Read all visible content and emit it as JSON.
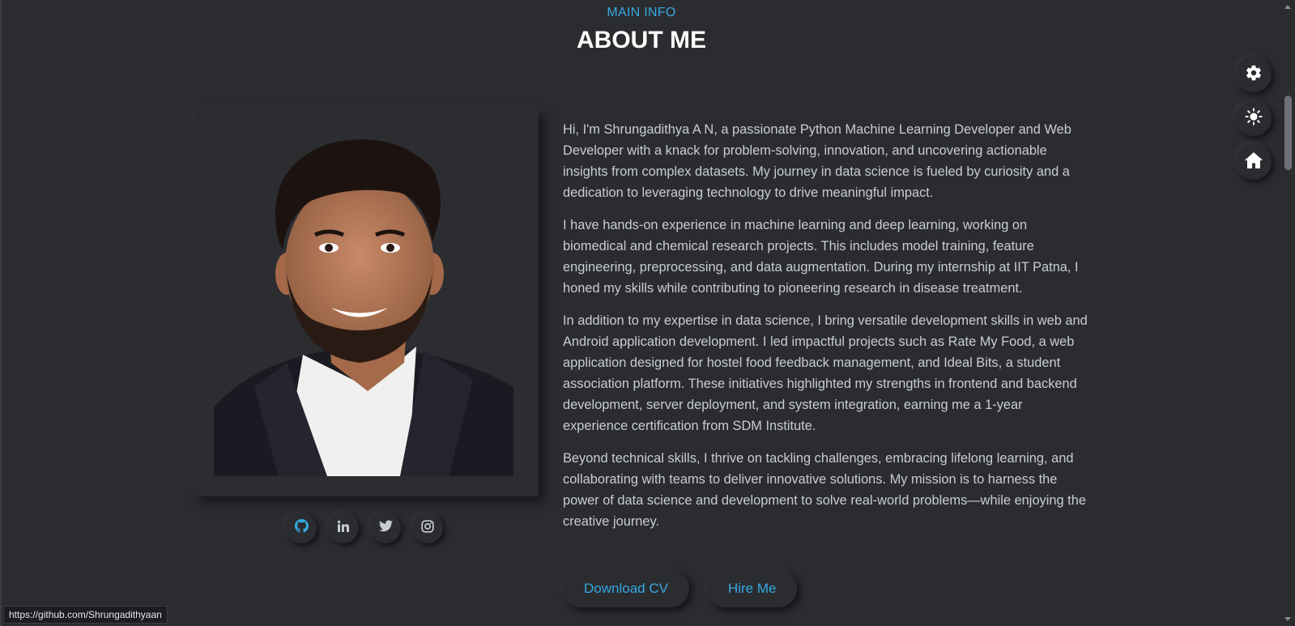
{
  "header": {
    "label": "MAIN INFO",
    "title": "ABOUT ME"
  },
  "profile": {
    "photo_alt": "Portrait of Shrungadithya A N"
  },
  "socials": [
    {
      "name": "GitHub",
      "icon": "github-icon",
      "color": "#36a9e1"
    },
    {
      "name": "LinkedIn",
      "icon": "linkedin-icon",
      "color": "#c9ccd1"
    },
    {
      "name": "Twitter",
      "icon": "twitter-icon",
      "color": "#c9ccd1"
    },
    {
      "name": "Instagram",
      "icon": "instagram-icon",
      "color": "#c9ccd1"
    }
  ],
  "bio": {
    "paragraphs": [
      "Hi, I'm Shrungadithya A N, a passionate Python Machine Learning Developer and Web Developer with a knack for problem-solving, innovation, and uncovering actionable insights from complex datasets. My journey in data science is fueled by curiosity and a dedication to leveraging technology to drive meaningful impact.",
      "I have hands-on experience in machine learning and deep learning, working on biomedical and chemical research projects. This includes model training, feature engineering, preprocessing, and data augmentation. During my internship at IIT Patna, I honed my skills while contributing to pioneering research in disease treatment.",
      "In addition to my expertise in data science, I bring versatile development skills in web and Android application development. I led impactful projects such as Rate My Food, a web application designed for hostel food feedback management, and Ideal Bits, a student association platform. These initiatives highlighted my strengths in frontend and backend development, server deployment, and system integration, earning me a 1-year experience certification from SDM Institute.",
      "Beyond technical skills, I thrive on tackling challenges, embracing lifelong learning, and collaborating with teams to deliver innovative solutions. My mission is to harness the power of data science and development to solve real-world problems—while enjoying the creative journey."
    ]
  },
  "actions": {
    "download_cv": "Download CV",
    "hire_me": "Hire Me"
  },
  "floating": {
    "settings_icon": "gear-icon",
    "theme_icon": "sun-icon",
    "home_icon": "home-icon"
  },
  "status_bar": {
    "url": "https://github.com/Shrungadithyaan"
  },
  "colors": {
    "background": "#2a2c30",
    "accent": "#36a9e1",
    "text": "#c9ccd1",
    "title": "#ffffff"
  }
}
